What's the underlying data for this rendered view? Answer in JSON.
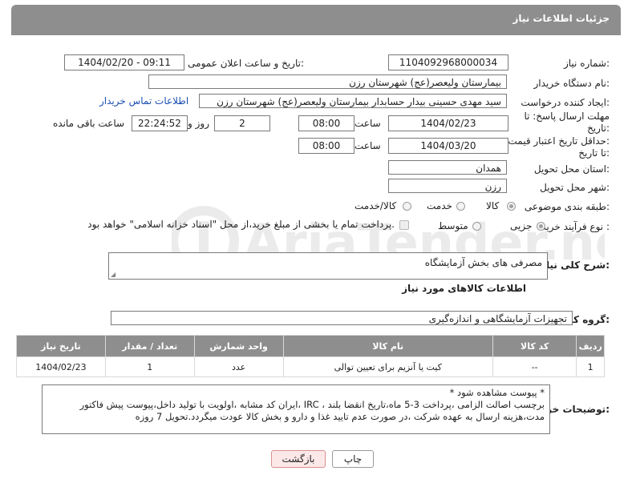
{
  "header": {
    "title": "جزئیات اطلاعات نیاز"
  },
  "fields": {
    "need_number_label": "شماره نیاز:",
    "need_number": "1104092968000034",
    "announce_label": "تاریخ و ساعت اعلان عمومی:",
    "announce_value": "1404/02/20 - 09:11",
    "buyer_org_label": "نام دستگاه خریدار:",
    "buyer_org": "بیمارستان ولیعصر(عج) شهرستان رزن",
    "creator_label": "ایجاد کننده درخواست:",
    "creator": "سید مهدی حسینی بیدار حسابدار بیمارستان ولیعصر(عج) شهرستان رزن",
    "contact_link": "اطلاعات تماس خریدار",
    "reply_deadline_label_1": "مهلت ارسال پاسخ: تا",
    "reply_deadline_label_2": "تاریخ:",
    "reply_date": "1404/02/23",
    "time_label": "ساعت",
    "reply_time": "08:00",
    "days_value": "2",
    "days_label": "روز و",
    "remaining_time": "22:24:52",
    "remaining_label": "ساعت باقی مانده",
    "price_deadline_label_1": "حداقل تاریخ اعتبار قیمت:",
    "price_deadline_label_2": "تا تاریخ:",
    "price_date": "1404/03/20",
    "price_time": "08:00",
    "province_label": "استان محل تحویل:",
    "province": "همدان",
    "city_label": "شهر محل تحویل:",
    "city": "رزن",
    "category_label": "طبقه بندی موضوعی:",
    "category_options": [
      "کالا",
      "خدمت",
      "کالا/خدمت"
    ],
    "category_selected": "کالا",
    "process_label": "نوع فرآیند خرید :",
    "process_options": [
      "جزیی",
      "متوسط"
    ],
    "process_selected": "جزیی",
    "payment_note": "پرداخت تمام یا بخشی از مبلغ خرید،از محل \"اسناد خزانه اسلامی\" خواهد بود."
  },
  "description": {
    "label": "شرح کلی نیاز:",
    "value": "مصرفی های بخش آزمایشگاه"
  },
  "goods_section": {
    "title": "اطلاعات کالاهای مورد نیاز",
    "group_label": "گروه کالا:",
    "group_value": "تجهیزات آزمایشگاهی و اندازه‌گیری"
  },
  "table": {
    "headers": [
      "ردیف",
      "کد کالا",
      "نام کالا",
      "واحد شمارش",
      "تعداد / مقدار",
      "تاریخ نیاز"
    ],
    "rows": [
      [
        "1",
        "--",
        "کیت یا آنزیم برای تعیین توالی",
        "عدد",
        "1",
        "1404/02/23"
      ]
    ]
  },
  "buyer_notes": {
    "label": "توضیحات خریدار:",
    "line1": "* پیوست مشاهده شود *",
    "line2": "ایران کد مشابه ،اولویت با تولید داخل،پیوست پیش فاکتور، IRC ، برچسب اصالت الزامی ،پرداخت 3-5 ماه،تاریخ انقضا بلند",
    "line3": "مدت،هزینه ارسال به عهده شرکت ،در صورت عدم تایید غذا و دارو و بخش کالا عودت میگردد.تحویل 7 روزه"
  },
  "buttons": {
    "print": "چاپ",
    "back": "بازگشت"
  },
  "watermark": {
    "text": "AriaTender.neT"
  }
}
